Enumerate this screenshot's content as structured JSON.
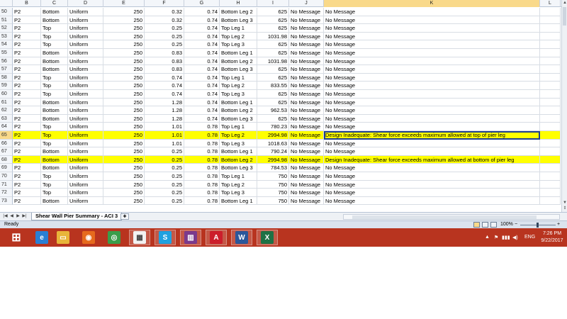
{
  "spreadsheet": {
    "column_headers": [
      "B",
      "C",
      "D",
      "E",
      "F",
      "G",
      "H",
      "I",
      "J",
      "K",
      "L"
    ],
    "selected_column": "K",
    "selected_row": "65",
    "rows": [
      {
        "n": "50",
        "b": "P2",
        "c": "Bottom",
        "d": "Uniform",
        "e": "250",
        "f": "0.32",
        "g": "0.74",
        "h": "Bottom Leg 2",
        "i": "625",
        "j": "No Message",
        "k": "No Message",
        "hl": false
      },
      {
        "n": "51",
        "b": "P2",
        "c": "Bottom",
        "d": "Uniform",
        "e": "250",
        "f": "0.32",
        "g": "0.74",
        "h": "Bottom Leg 3",
        "i": "625",
        "j": "No Message",
        "k": "No Message",
        "hl": false
      },
      {
        "n": "52",
        "b": "P2",
        "c": "Top",
        "d": "Uniform",
        "e": "250",
        "f": "0.25",
        "g": "0.74",
        "h": "Top Leg 1",
        "i": "625",
        "j": "No Message",
        "k": "No Message",
        "hl": false
      },
      {
        "n": "53",
        "b": "P2",
        "c": "Top",
        "d": "Uniform",
        "e": "250",
        "f": "0.25",
        "g": "0.74",
        "h": "Top Leg 2",
        "i": "1031.98",
        "j": "No Message",
        "k": "No Message",
        "hl": false
      },
      {
        "n": "54",
        "b": "P2",
        "c": "Top",
        "d": "Uniform",
        "e": "250",
        "f": "0.25",
        "g": "0.74",
        "h": "Top Leg 3",
        "i": "625",
        "j": "No Message",
        "k": "No Message",
        "hl": false
      },
      {
        "n": "55",
        "b": "P2",
        "c": "Bottom",
        "d": "Uniform",
        "e": "250",
        "f": "0.83",
        "g": "0.74",
        "h": "Bottom Leg 1",
        "i": "625",
        "j": "No Message",
        "k": "No Message",
        "hl": false
      },
      {
        "n": "56",
        "b": "P2",
        "c": "Bottom",
        "d": "Uniform",
        "e": "250",
        "f": "0.83",
        "g": "0.74",
        "h": "Bottom Leg 2",
        "i": "1031.98",
        "j": "No Message",
        "k": "No Message",
        "hl": false
      },
      {
        "n": "57",
        "b": "P2",
        "c": "Bottom",
        "d": "Uniform",
        "e": "250",
        "f": "0.83",
        "g": "0.74",
        "h": "Bottom Leg 3",
        "i": "625",
        "j": "No Message",
        "k": "No Message",
        "hl": false
      },
      {
        "n": "58",
        "b": "P2",
        "c": "Top",
        "d": "Uniform",
        "e": "250",
        "f": "0.74",
        "g": "0.74",
        "h": "Top Leg 1",
        "i": "625",
        "j": "No Message",
        "k": "No Message",
        "hl": false
      },
      {
        "n": "59",
        "b": "P2",
        "c": "Top",
        "d": "Uniform",
        "e": "250",
        "f": "0.74",
        "g": "0.74",
        "h": "Top Leg 2",
        "i": "833.55",
        "j": "No Message",
        "k": "No Message",
        "hl": false
      },
      {
        "n": "60",
        "b": "P2",
        "c": "Top",
        "d": "Uniform",
        "e": "250",
        "f": "0.74",
        "g": "0.74",
        "h": "Top Leg 3",
        "i": "625",
        "j": "No Message",
        "k": "No Message",
        "hl": false
      },
      {
        "n": "61",
        "b": "P2",
        "c": "Bottom",
        "d": "Uniform",
        "e": "250",
        "f": "1.28",
        "g": "0.74",
        "h": "Bottom Leg 1",
        "i": "625",
        "j": "No Message",
        "k": "No Message",
        "hl": false
      },
      {
        "n": "62",
        "b": "P2",
        "c": "Bottom",
        "d": "Uniform",
        "e": "250",
        "f": "1.28",
        "g": "0.74",
        "h": "Bottom Leg 2",
        "i": "962.53",
        "j": "No Message",
        "k": "No Message",
        "hl": false
      },
      {
        "n": "63",
        "b": "P2",
        "c": "Bottom",
        "d": "Uniform",
        "e": "250",
        "f": "1.28",
        "g": "0.74",
        "h": "Bottom Leg 3",
        "i": "625",
        "j": "No Message",
        "k": "No Message",
        "hl": false
      },
      {
        "n": "64",
        "b": "P2",
        "c": "Top",
        "d": "Uniform",
        "e": "250",
        "f": "1.01",
        "g": "0.78",
        "h": "Top Leg 1",
        "i": "780.23",
        "j": "No Message",
        "k": "No Message",
        "hl": false
      },
      {
        "n": "65",
        "b": "P2",
        "c": "Top",
        "d": "Uniform",
        "e": "250",
        "f": "1.01",
        "g": "0.78",
        "h": "Top Leg 2",
        "i": "2994.98",
        "j": "No Message",
        "k": "Design Inadequate: Shear force exceeds maximum allowed at top of pier leg",
        "hl": true
      },
      {
        "n": "66",
        "b": "P2",
        "c": "Top",
        "d": "Uniform",
        "e": "250",
        "f": "1.01",
        "g": "0.78",
        "h": "Top Leg 3",
        "i": "1018.63",
        "j": "No Message",
        "k": "No Message",
        "hl": false
      },
      {
        "n": "67",
        "b": "P2",
        "c": "Bottom",
        "d": "Uniform",
        "e": "250",
        "f": "0.25",
        "g": "0.78",
        "h": "Bottom Leg 1",
        "i": "790.24",
        "j": "No Message",
        "k": "No Message",
        "hl": false
      },
      {
        "n": "68",
        "b": "P2",
        "c": "Bottom",
        "d": "Uniform",
        "e": "250",
        "f": "0.25",
        "g": "0.78",
        "h": "Bottom Leg 2",
        "i": "2994.98",
        "j": "No Message",
        "k": "Design Inadequate: Shear force exceeds maximum allowed at bottom of pier leg",
        "hl": true
      },
      {
        "n": "69",
        "b": "P2",
        "c": "Bottom",
        "d": "Uniform",
        "e": "250",
        "f": "0.25",
        "g": "0.78",
        "h": "Bottom Leg 3",
        "i": "784.53",
        "j": "No Message",
        "k": "No Message",
        "hl": false
      },
      {
        "n": "70",
        "b": "P2",
        "c": "Top",
        "d": "Uniform",
        "e": "250",
        "f": "0.25",
        "g": "0.78",
        "h": "Top Leg 1",
        "i": "750",
        "j": "No Message",
        "k": "No Message",
        "hl": false
      },
      {
        "n": "71",
        "b": "P2",
        "c": "Top",
        "d": "Uniform",
        "e": "250",
        "f": "0.25",
        "g": "0.78",
        "h": "Top Leg 2",
        "i": "750",
        "j": "No Message",
        "k": "No Message",
        "hl": false
      },
      {
        "n": "72",
        "b": "P2",
        "c": "Top",
        "d": "Uniform",
        "e": "250",
        "f": "0.25",
        "g": "0.78",
        "h": "Top Leg 3",
        "i": "750",
        "j": "No Message",
        "k": "No Message",
        "hl": false
      },
      {
        "n": "73",
        "b": "P2",
        "c": "Bottom",
        "d": "Uniform",
        "e": "250",
        "f": "0.25",
        "g": "0.78",
        "h": "Bottom Leg 1",
        "i": "750",
        "j": "No Message",
        "k": "No Message",
        "hl": false
      }
    ]
  },
  "sheet_tabs": {
    "active_tab": "Shear Wall Pier Summary - ACI 3",
    "nav_icons": [
      "first-sheet-icon",
      "prev-sheet-icon",
      "next-sheet-icon",
      "last-sheet-icon"
    ]
  },
  "status_bar": {
    "status": "Ready",
    "zoom": "100%",
    "zoom_minus": "−",
    "zoom_plus": "+"
  },
  "taskbar": {
    "apps": [
      {
        "icon": "windows-start-icon",
        "color": "#b8341f"
      },
      {
        "icon": "internet-explorer-icon",
        "color": "#2a7fd4"
      },
      {
        "icon": "file-explorer-icon",
        "color": "#e8b53a"
      },
      {
        "icon": "firefox-icon",
        "color": "#e66a1d"
      },
      {
        "icon": "chrome-icon",
        "color": "#3a9d4a"
      },
      {
        "icon": "calendar-app-icon",
        "color": "#f2f2f2"
      },
      {
        "icon": "skype-icon",
        "color": "#1fa1e0"
      },
      {
        "icon": "winrar-icon",
        "color": "#7b3a8c"
      },
      {
        "icon": "autocad-icon",
        "color": "#cc1e2b"
      },
      {
        "icon": "word-icon",
        "color": "#2b579a"
      },
      {
        "icon": "excel-icon",
        "color": "#1e7145"
      }
    ],
    "language": "ENG",
    "time": "7:26 PM",
    "date": "9/22/2017",
    "colors": {
      "taskbar": "#b8341f",
      "highlight": "#ffff00",
      "selected_header": "#f9d98a"
    }
  }
}
